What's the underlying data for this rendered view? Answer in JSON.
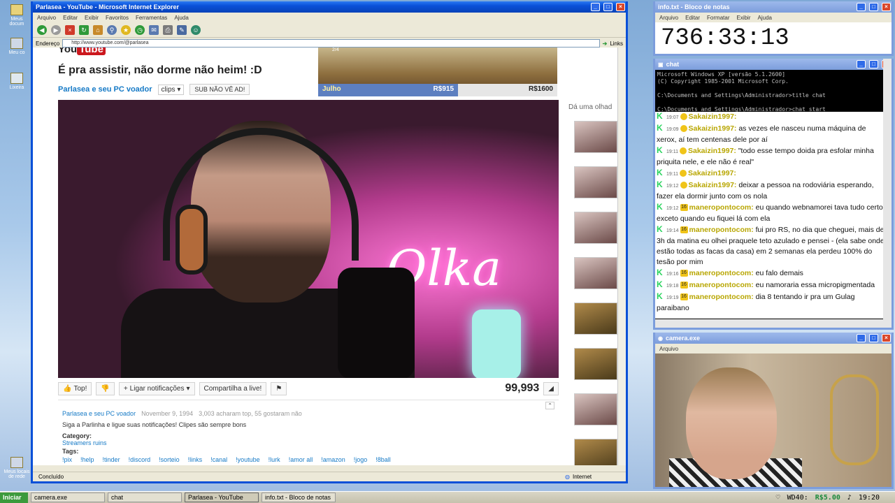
{
  "desktop": {
    "icons": [
      "Meus docum",
      "Meu co",
      "Lixeira",
      "Meus locais de rede"
    ]
  },
  "ie": {
    "title": "Parlasea - YouTube - Microsoft Internet Explorer",
    "menu": [
      "Arquivo",
      "Editar",
      "Exibir",
      "Favoritos",
      "Ferramentas",
      "Ajuda"
    ],
    "address_label": "Endereço",
    "address": "http://www.youtube.com/@parlasea",
    "links_label": "Links",
    "status": "Concluído",
    "zone": "Internet"
  },
  "youtube": {
    "logo_you": "You",
    "logo_tube": "Tube",
    "video_title": "É pra assistir, não dorme não heim! :D",
    "channel": "Parlasea e seu PC voador",
    "clips_label": "clips",
    "sub_button": "SUB NÃO VÊ AD!",
    "neon_text": "Olka",
    "top_button": "Top!",
    "notify_button": "Ligar notificações",
    "share_button": "Compartilha a live!",
    "views": "99,993",
    "meta_channel": "Parlasea e seu PC voador",
    "meta_date": "November 9, 1994",
    "meta_likes": "3,003 acharam top, 55 gostaram não",
    "description": "Siga a Parlinha e ligue suas notificações! Clipes são sempre bons",
    "category_label": "Category:",
    "category": "Streamers ruins",
    "tags_label": "Tags:",
    "tags": [
      "!pix",
      "!help",
      "!tinder",
      "!discord",
      "!sorteio",
      "!links",
      "!canal",
      "!youtube",
      "!lurk",
      "!amor all",
      "!amazon",
      "!jogo",
      "!8ball"
    ],
    "related_header": "Dá uma olhad"
  },
  "game": {
    "player": "Julho",
    "score_a": "R$915",
    "score_b": "R$1600",
    "counter": "2/4"
  },
  "notepad": {
    "title": "info.txt - Bloco de notas",
    "menu": [
      "Arquivo",
      "Editar",
      "Formatar",
      "Exibir",
      "Ajuda"
    ],
    "content": "736:33:13"
  },
  "cmd": {
    "title": "chat",
    "console": "Microsoft Windows XP [versão 5.1.2600]\n(C) Copyright 1985-2001 Microsoft Corp.\n\nC:\\Documents and Settings\\Administrador>title chat\n\nC:\\Documents and Settings\\Administrador>chat start",
    "messages": [
      {
        "time": "19:07",
        "user": "Sakaizin1997:",
        "text": ""
      },
      {
        "time": "19:09",
        "user": "Sakaizin1997:",
        "text": "as vezes ele nasceu numa máquina de xerox, aí tem centenas dele por aí"
      },
      {
        "time": "19:11",
        "user": "Sakaizin1997:",
        "text": "\"todo esse tempo doida pra esfolar minha priquita nele, e ele não é real\""
      },
      {
        "time": "19:11",
        "user": "Sakaizin1997:",
        "text": ""
      },
      {
        "time": "19:12",
        "user": "Sakaizin1997:",
        "text": "deixar a pessoa na rodoviária esperando, fazer ela dormir junto com os nola"
      },
      {
        "time": "19:12",
        "badge": "16",
        "user": "maneropontocom:",
        "text": "eu quando webnamorei tava tudo certo, exceto quando eu fiquei lá com ela"
      },
      {
        "time": "19:14",
        "badge": "16",
        "user": "maneropontocom:",
        "text": "fui pro RS, no dia que cheguei, mais de 3h da matina eu olhei praquele teto azulado e pensei - (ela sabe onde estão todas as facas da casa) em 2 semanas ela perdeu 100% do tesão por mim"
      },
      {
        "time": "19:16",
        "badge": "16",
        "user": "maneropontocom:",
        "text": "eu falo demais"
      },
      {
        "time": "19:18",
        "badge": "16",
        "user": "maneropontocom:",
        "text": "eu namoraria essa micropigmentada"
      },
      {
        "time": "19:19",
        "badge": "16",
        "user": "maneropontocom:",
        "text": "dia 8 tentando ir pra um Gulag paraibano"
      }
    ]
  },
  "camera": {
    "title": "camera.exe",
    "menu": "Arquivo"
  },
  "taskbar": {
    "start": "Iniciar",
    "tasks": [
      "camera.exe",
      "chat",
      "Parlasea - YouTube",
      "info.txt - Bloco de notas"
    ],
    "tray_label": "WD40:",
    "tray_money": "R$5.00",
    "clock": "19:20"
  }
}
